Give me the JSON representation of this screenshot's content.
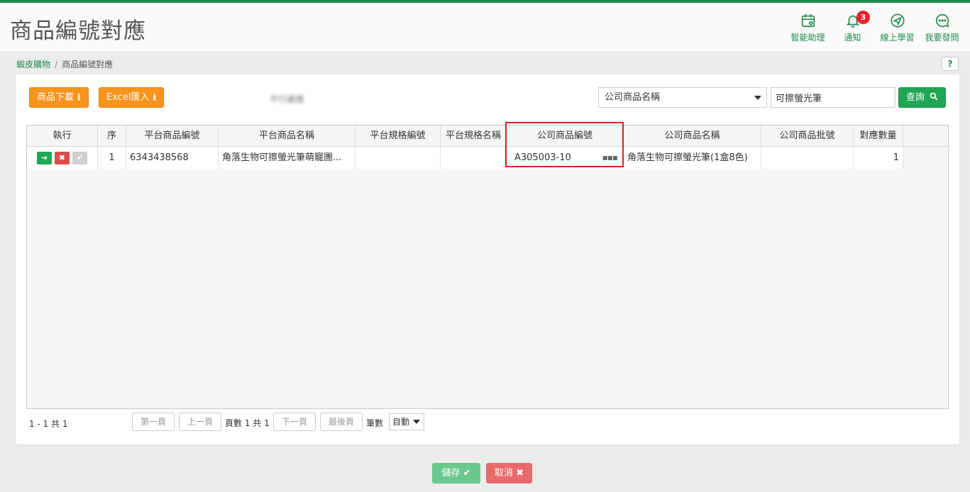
{
  "header": {
    "title": "商品編號對應",
    "actions": [
      {
        "label": "智能助理",
        "icon": "calendar-icon"
      },
      {
        "label": "通知",
        "icon": "bell-icon",
        "badge": "3"
      },
      {
        "label": "線上學習",
        "icon": "paper-plane-icon"
      },
      {
        "label": "我要發問",
        "icon": "chat-icon"
      }
    ]
  },
  "breadcrumb": {
    "parent": "蝦皮購物",
    "separator": "/",
    "current": "商品編號對應"
  },
  "help_label": "?",
  "toolbar": {
    "download_label": "商品下載",
    "import_label": "Excel匯入",
    "blurred_text": "平行處理",
    "search_field_option": "公司商品名稱",
    "search_value": "可擦螢光筆",
    "query_label": "查詢"
  },
  "grid": {
    "columns": [
      "執行",
      "序",
      "平台商品編號",
      "平台商品名稱",
      "平台規格編號",
      "平台規格名稱",
      "公司商品編號",
      "公司商品名稱",
      "公司商品批號",
      "對應數量"
    ],
    "rows": [
      {
        "seq": "1",
        "platform_product_no": "6343438568",
        "platform_product_name": "角落生物可擦螢光筆萌寵團...",
        "platform_spec_no": "",
        "platform_spec_name": "",
        "company_product_no": "A305003-10",
        "company_product_name": "角落生物可擦螢光筆(1盒8色)",
        "company_batch_no": "",
        "qty": "1"
      }
    ]
  },
  "pager": {
    "info": "1 - 1 共 1",
    "first": "第一頁",
    "prev": "上一頁",
    "page_text": "頁數 1 共 1",
    "next": "下一頁",
    "last": "最後頁",
    "size_label": "筆數",
    "size_value": "自動"
  },
  "footer": {
    "save_label": "儲存",
    "cancel_label": "取消"
  },
  "colors": {
    "brand": "#1e8a4a",
    "orange": "#f7941d",
    "red": "#e8222a",
    "highlight": "#d62020"
  }
}
